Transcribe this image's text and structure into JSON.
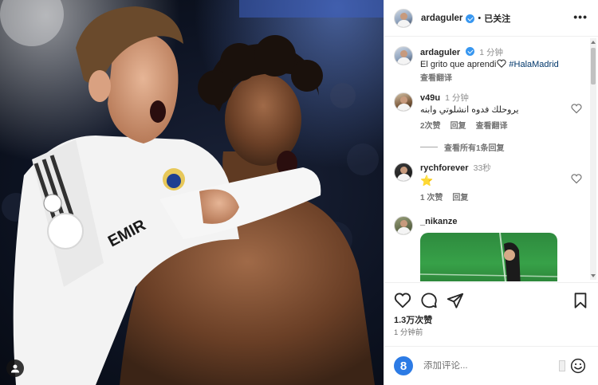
{
  "post": {
    "username": "ardaguler",
    "follow_status": "已关注",
    "dot": "•",
    "more": "•••"
  },
  "caption": {
    "username": "ardaguler",
    "time": "1 分钟",
    "text": "El grito que aprendi",
    "hashtag": "#HalaMadrid",
    "see_translation": "查看翻译"
  },
  "comments": [
    {
      "username": "v49u",
      "time": "1 分钟",
      "text": "يروحلك فدوه انشلوتي وابنه",
      "likes": "2次赞",
      "reply": "回复",
      "translate": "查看翻译"
    },
    {
      "username": "rychforever",
      "time": "33秒",
      "text": "⭐",
      "likes": "1 次赞",
      "reply": "回复"
    },
    {
      "username": "_nikanze"
    }
  ],
  "view_replies": "查看所有1条回复",
  "footer": {
    "likes": "1.3万次赞",
    "posted": "1 分钟前",
    "comment_placeholder": "添加评论..."
  },
  "icons": {
    "heart": "heart-icon",
    "comment": "comment-icon",
    "share": "share-icon",
    "bookmark": "bookmark-icon",
    "emoji": "emoji-icon",
    "user_tag": "user-tag-icon"
  },
  "colors": {
    "verified": "#3897f0",
    "hashtag": "#00376b",
    "muted": "#737373",
    "emoji_badge": "#2c7be5"
  }
}
